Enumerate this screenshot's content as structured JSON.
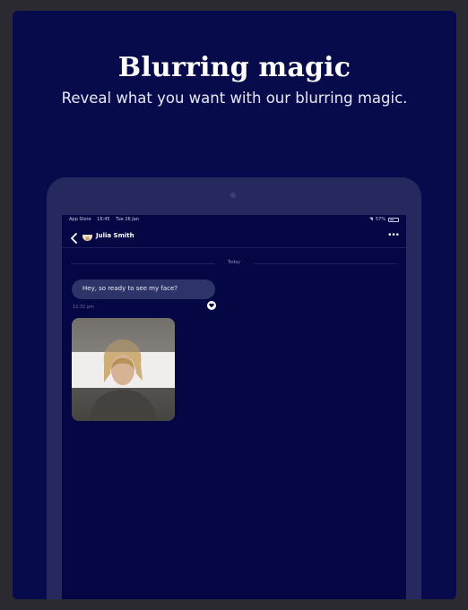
{
  "hero": {
    "title": "Blurring magic",
    "subtitle": "Reveal what you want with our blurring magic."
  },
  "status_bar": {
    "carrier": "App Store",
    "time": "16:45",
    "date": "Tue 26 Jan",
    "battery": "57%"
  },
  "chat": {
    "contact_name": "Julia Smith",
    "more_label": "•••",
    "day_divider": "Today",
    "messages": [
      {
        "text": "Hey, so ready to see my face?",
        "time": "12:31 pm"
      }
    ],
    "photo": {
      "blur_state": "partially revealed"
    }
  },
  "colors": {
    "background": "#070b4b",
    "screen": "#040743",
    "bubble": "#2f3468",
    "tablet_bezel": "#25295e"
  },
  "icons": [
    "back-chevron-icon",
    "avatar",
    "more-icon",
    "heart-icon",
    "wifi-icon",
    "battery-icon",
    "camera-dot"
  ]
}
